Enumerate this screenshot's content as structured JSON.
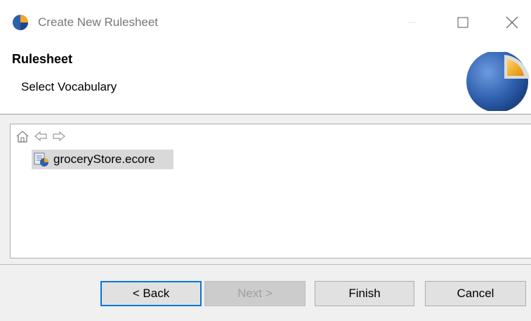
{
  "window": {
    "title": "Create New Rulesheet",
    "icon": "corticon-app-icon"
  },
  "header": {
    "title": "Rulesheet",
    "message": "Select Vocabulary",
    "image": "corticon-logo-pie"
  },
  "toolbar": {
    "home_icon": "home-icon",
    "back_icon": "back-arrow-icon",
    "forward_icon": "forward-arrow-icon"
  },
  "tree": {
    "items": [
      {
        "label": "groceryStore.ecore",
        "icon": "vocabulary-file-icon",
        "selected": true
      }
    ]
  },
  "buttons": {
    "back": "< Back",
    "next": "Next >",
    "finish": "Finish",
    "cancel": "Cancel"
  },
  "colors": {
    "accent": "#0078d7",
    "selection": "#d9d9d9",
    "logo_blue": "#2e5fae",
    "logo_orange": "#f5a623"
  }
}
